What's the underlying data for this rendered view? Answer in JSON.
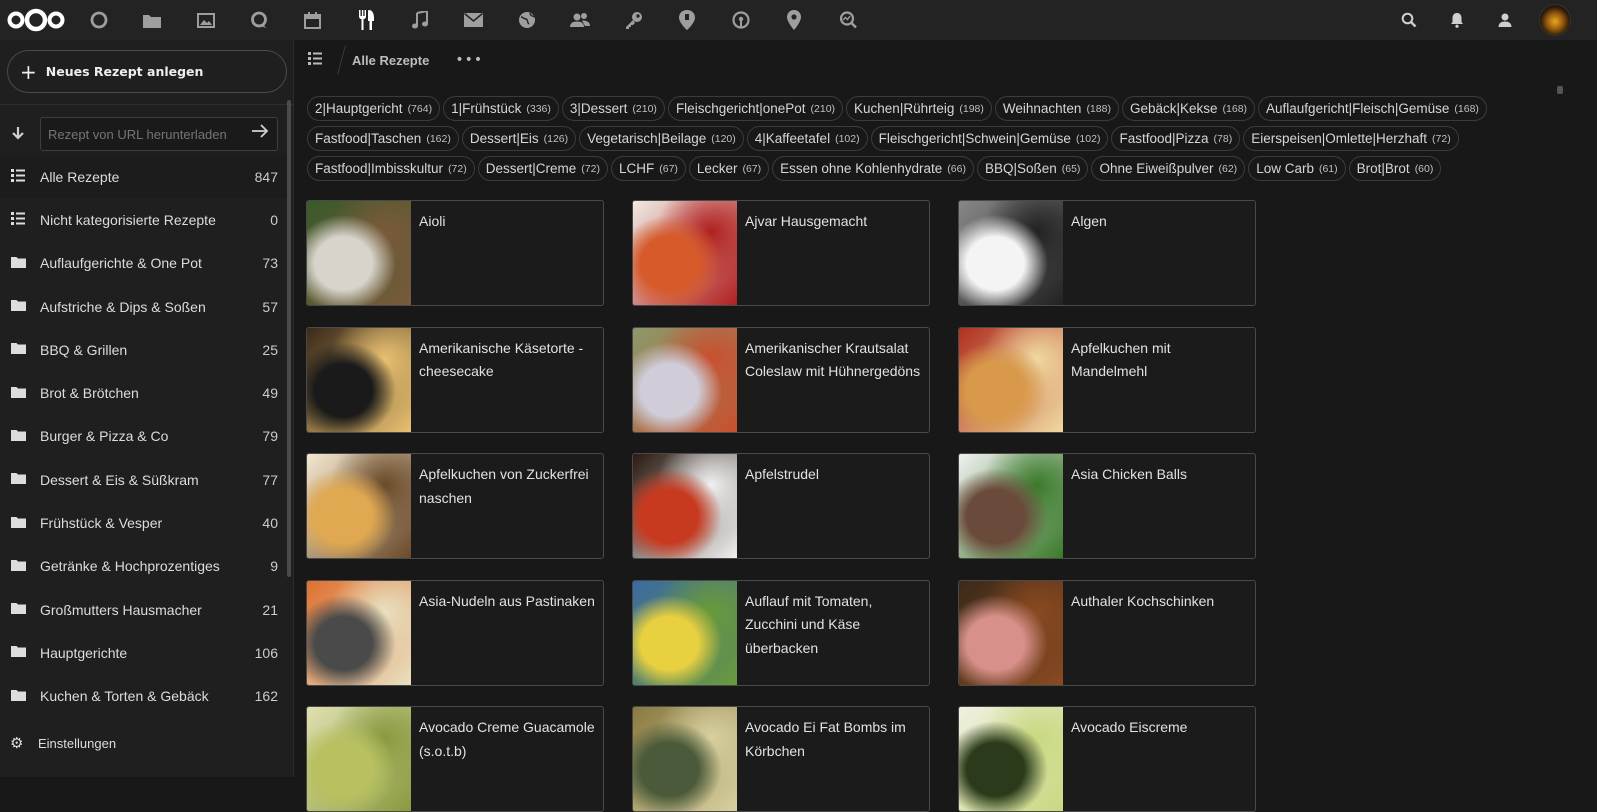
{
  "topbar": {
    "apps": [
      "dashboard-icon",
      "files-icon",
      "photos-icon",
      "talk-icon",
      "calendar-icon",
      "cookbook-icon",
      "music-icon",
      "mail-icon",
      "web-icon",
      "contacts-icon",
      "passwords-icon",
      "tracking-icon",
      "radio-icon",
      "maps-icon",
      "search-analytics-icon"
    ],
    "right": [
      "search-icon",
      "notifications-icon",
      "contacts-menu-icon"
    ]
  },
  "sidebar": {
    "new_button": "Neues Rezept anlegen",
    "url_placeholder": "Rezept von URL herunterladen",
    "items": [
      {
        "label": "Alle Rezepte",
        "count": "847",
        "icon": "list"
      },
      {
        "label": "Nicht kategorisierte Rezepte",
        "count": "0",
        "icon": "list"
      },
      {
        "label": "Auflaufgerichte & One Pot",
        "count": "73",
        "icon": "folder"
      },
      {
        "label": "Aufstriche & Dips & Soßen",
        "count": "57",
        "icon": "folder"
      },
      {
        "label": "BBQ & Grillen",
        "count": "25",
        "icon": "folder"
      },
      {
        "label": "Brot & Brötchen",
        "count": "49",
        "icon": "folder"
      },
      {
        "label": "Burger & Pizza & Co",
        "count": "79",
        "icon": "folder"
      },
      {
        "label": "Dessert & Eis & Süßkram",
        "count": "77",
        "icon": "folder"
      },
      {
        "label": "Frühstück & Vesper",
        "count": "40",
        "icon": "folder"
      },
      {
        "label": "Getränke & Hochprozentiges",
        "count": "9",
        "icon": "folder"
      },
      {
        "label": "Großmutters Hausmacher",
        "count": "21",
        "icon": "folder"
      },
      {
        "label": "Hauptgerichte",
        "count": "106",
        "icon": "folder"
      },
      {
        "label": "Kuchen & Torten & Gebäck",
        "count": "162",
        "icon": "folder"
      }
    ],
    "settings": "Einstellungen"
  },
  "main": {
    "breadcrumb": "Alle Rezepte",
    "more": "•••",
    "tags": [
      {
        "name": "2|Hauptgericht",
        "count": "(764)"
      },
      {
        "name": "1|Frühstück",
        "count": "(336)"
      },
      {
        "name": "3|Dessert",
        "count": "(210)"
      },
      {
        "name": "Fleischgericht|onePot",
        "count": "(210)"
      },
      {
        "name": "Kuchen|Rührteig",
        "count": "(198)"
      },
      {
        "name": "Weihnachten",
        "count": "(188)"
      },
      {
        "name": "Gebäck|Kekse",
        "count": "(168)"
      },
      {
        "name": "Auflaufgericht|Fleisch|Gemüse",
        "count": "(168)"
      },
      {
        "name": "Fastfood|Taschen",
        "count": "(162)"
      },
      {
        "name": "Dessert|Eis",
        "count": "(126)"
      },
      {
        "name": "Vegetarisch|Beilage",
        "count": "(120)"
      },
      {
        "name": "4|Kaffeetafel",
        "count": "(102)"
      },
      {
        "name": "Fleischgericht|Schwein|Gemüse",
        "count": "(102)"
      },
      {
        "name": "Fastfood|Pizza",
        "count": "(78)"
      },
      {
        "name": "Eierspeisen|Omlette|Herzhaft",
        "count": "(72)"
      },
      {
        "name": "Fastfood|Imbisskultur",
        "count": "(72)"
      },
      {
        "name": "Dessert|Creme",
        "count": "(72)"
      },
      {
        "name": "LCHF",
        "count": "(67)"
      },
      {
        "name": "Lecker",
        "count": "(67)"
      },
      {
        "name": "Essen ohne Kohlenhydrate",
        "count": "(66)"
      },
      {
        "name": "BBQ|Soßen",
        "count": "(65)"
      },
      {
        "name": "Ohne Eiweißpulver",
        "count": "(62)"
      },
      {
        "name": "Low Carb",
        "count": "(61)"
      },
      {
        "name": "Brot|Brot",
        "count": "(60)"
      }
    ],
    "recipes": [
      {
        "title": "Aioli",
        "thumb": [
          "#d8d4cc",
          "#7a5a3a",
          "#3a5a2a"
        ]
      },
      {
        "title": "Ajvar Hausgemacht",
        "thumb": [
          "#d65a2a",
          "#b02020",
          "#f0ece4"
        ]
      },
      {
        "title": "Algen",
        "thumb": [
          "#f4f4f4",
          "#222222",
          "#888888"
        ]
      },
      {
        "title": "Amerikanische Käsetorte - cheesecake",
        "thumb": [
          "#1a1a1a",
          "#e8c070",
          "#3a2a1a"
        ]
      },
      {
        "title": "Amerikanischer Krautsalat Coleslaw mit Hühnergedöns",
        "thumb": [
          "#d0ccd8",
          "#c85030",
          "#8a9a6a"
        ]
      },
      {
        "title": "Apfelkuchen mit Mandelmehl",
        "thumb": [
          "#d89a4a",
          "#f0d8a0",
          "#b03020"
        ]
      },
      {
        "title": "Apfelkuchen von Zuckerfrei naschen",
        "thumb": [
          "#e0a850",
          "#6a4a2a",
          "#f4e8d0"
        ]
      },
      {
        "title": "Apfelstrudel",
        "thumb": [
          "#c83a20",
          "#f0f0f0",
          "#2a1a10"
        ]
      },
      {
        "title": "Asia Chicken Balls",
        "thumb": [
          "#6a4a3a",
          "#3a7a2a",
          "#f0f0f0"
        ]
      },
      {
        "title": "Asia-Nudeln aus Pastinaken",
        "thumb": [
          "#4a4a4a",
          "#e8e0c0",
          "#e07030"
        ]
      },
      {
        "title": "Auflauf mit Tomaten, Zucchini und Käse überbacken",
        "thumb": [
          "#e8d040",
          "#6a9a3a",
          "#3a6aa0"
        ]
      },
      {
        "title": "Authaler Kochschinken",
        "thumb": [
          "#d8908a",
          "#8a4a20",
          "#3a2a1a"
        ]
      },
      {
        "title": "Avocado Creme Guacamole (s.o.t.b)",
        "thumb": [
          "#b8c060",
          "#8a9a40",
          "#e0e0b0"
        ]
      },
      {
        "title": "Avocado Ei Fat Bombs im Körbchen",
        "thumb": [
          "#4a5a3a",
          "#d8d0a0",
          "#8a7a40"
        ]
      },
      {
        "title": "Avocado Eiscreme",
        "thumb": [
          "#2a3a1a",
          "#c8d880",
          "#f0f0e0"
        ]
      }
    ]
  }
}
